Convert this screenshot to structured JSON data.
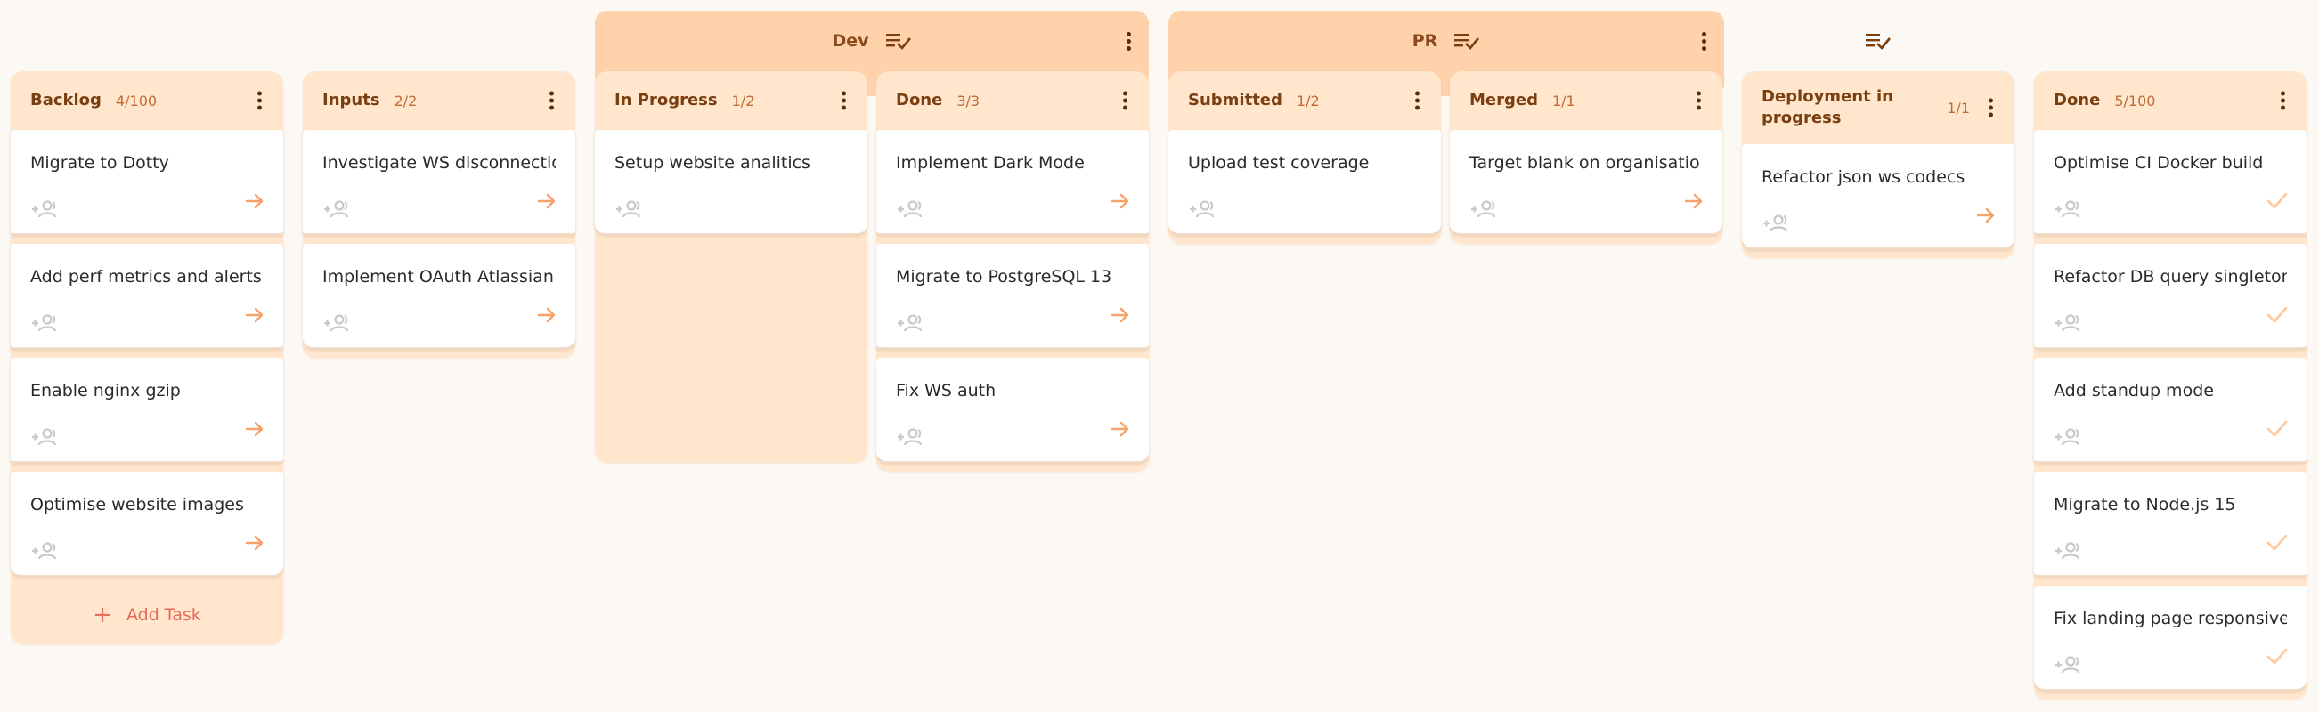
{
  "colors": {
    "background": "#fcf8f3",
    "group_header": "#ffd2ab",
    "column_bg": "#ffe6cd",
    "title_brown": "#7a3f10",
    "count_orange": "#c26b36",
    "arrow_orange": "#f7a26b",
    "add_task_red": "#e76a5a"
  },
  "groups": {
    "dev": {
      "title": "Dev",
      "icon": "sort-check-icon"
    },
    "pr": {
      "title": "PR",
      "icon": "sort-check-icon"
    },
    "deploy": {
      "title": "",
      "icon": "sort-check-icon"
    }
  },
  "columns": [
    {
      "title": "Backlog",
      "count": "4/100",
      "cards": [
        "Migrate to Dotty",
        "Add perf metrics and alerts ...",
        "Enable nginx gzip",
        "Optimise website images"
      ],
      "add_label": "Add Task"
    },
    {
      "title": "Inputs",
      "count": "2/2",
      "cards": [
        "Investigate WS disconnectio ...",
        "Implement OAuth Atlassian"
      ]
    },
    {
      "title": "In Progress",
      "count": "1/2",
      "cards": [
        "Setup website analitics"
      ]
    },
    {
      "title": "Done",
      "count": "3/3",
      "cards": [
        "Implement Dark Mode",
        "Migrate to PostgreSQL 13",
        "Fix WS auth"
      ]
    },
    {
      "title": "Submitted",
      "count": "1/2",
      "cards": [
        "Upload test coverage"
      ]
    },
    {
      "title": "Merged",
      "count": "1/1",
      "cards": [
        "Target blank on organisatio ..."
      ]
    },
    {
      "title": "Deployment in progress",
      "count": "1/1",
      "cards": [
        "Refactor json ws codecs"
      ]
    },
    {
      "title": "Done",
      "count": "5/100",
      "cards": [
        "Optimise CI Docker build",
        "Refactor DB query singleton ...",
        "Add standup mode",
        "Migrate to Node.js 15",
        "Fix landing page responsive ..."
      ]
    }
  ]
}
